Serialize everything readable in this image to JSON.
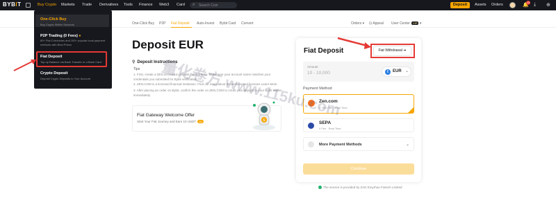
{
  "topbar": {
    "logo": "BYBIT",
    "nav": [
      "Buy Crypto",
      "Markets",
      "Trade",
      "Derivatives",
      "Tools",
      "Finance",
      "Web3",
      "Card"
    ],
    "search_placeholder": "Search Coin",
    "deposit_label": "Deposit",
    "assets_label": "Assets",
    "orders_label": "Orders",
    "notification_count": "15"
  },
  "subnav": {
    "items": [
      "One-Click Buy",
      "P2P",
      "Fiat Deposit",
      "Auto-Invest",
      "Bybit Card",
      "Convert"
    ],
    "right": [
      "Orders",
      "Appeal",
      "User Center"
    ],
    "vip": "VIP"
  },
  "dropdown": {
    "items": [
      {
        "title": "One-Click Buy",
        "desc": "Buy Crypto Within Seconds"
      },
      {
        "title": "P2P Trading (0 Fees)",
        "desc": "60+ Fiat Currencies and 100+ popular local payment methods with Best Prices"
      },
      {
        "title": "Fiat Deposit",
        "desc": "Top up Balance via Bank Transfer or a Bank Card"
      },
      {
        "title": "Crypto Deposit",
        "desc": "Deposit Crypto Deposits to Your Account"
      }
    ]
  },
  "main": {
    "title": "Deposit EUR",
    "instructions_label": "Deposit Instructions",
    "tips_label": "Tips",
    "tips": [
      "1. First, create a ZEN account to deposit fiat currency. Make sure your account name matches your credentials you submitted for Bybit verification.",
      "2. ZEN.COM is a licensed financial institution. Find out more about its services and licenses Learn More",
      "3. After placing an order on Bybit, confirm the order on ZEN.COM to credit your deposit to your Bybit Wallet immediately."
    ],
    "offer_title": "Fiat Gateway Welcome Offer",
    "offer_sub": "Start Your Fiat Journey and Earn 10 USDT",
    "offer_badge": "Go"
  },
  "card": {
    "title": "Fiat Deposit",
    "withdraw_label": "Fiat Withdrawal ➜",
    "amount_label": "Amount",
    "amount_placeholder": "10 - 10,000",
    "currency": "EUR",
    "payment_method_label": "Payment Method",
    "methods": [
      {
        "name": "Zen.com",
        "fee": "0.75% Fee",
        "time": "Real Time"
      },
      {
        "name": "SEPA",
        "fee": "0 Fee",
        "time": "Real Time"
      }
    ],
    "more_label": "More Payment Methods",
    "continue_label": "Continue",
    "provided_text": "The service is provided by ZAD Emyrhao Fintech Limited"
  },
  "watermark": "量化卷方 www.115ku.com",
  "colors": {
    "accent": "#f7a600",
    "topbar": "#17181e",
    "highlight": "#e53935"
  }
}
